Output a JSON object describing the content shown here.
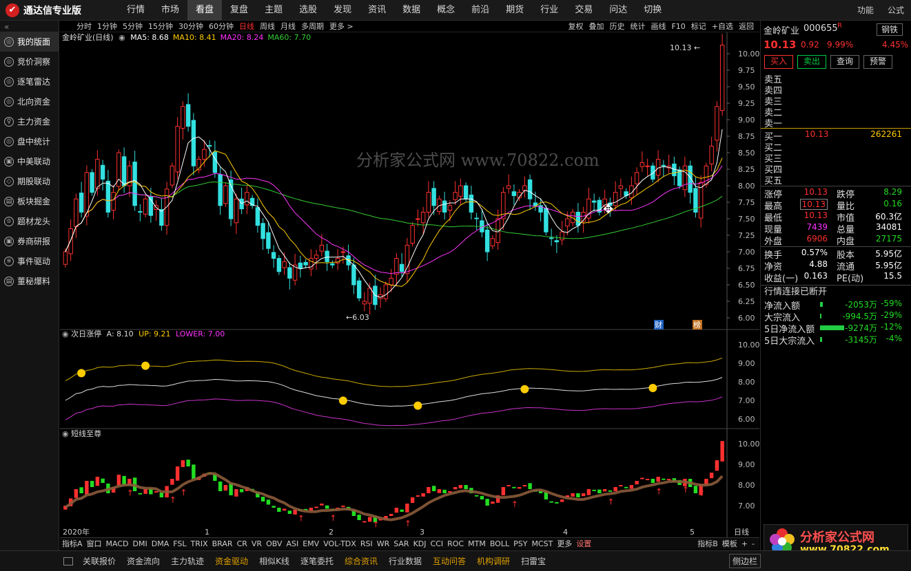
{
  "app": {
    "name": "通达信专业版"
  },
  "menu": [
    "行情",
    "市场",
    "看盘",
    "复盘",
    "主题",
    "选股",
    "发现",
    "资讯",
    "数据",
    "概念",
    "前沿",
    "期货",
    "行业",
    "交易",
    "问达",
    "切换"
  ],
  "menu_active": 2,
  "top_right": [
    "功能",
    "公式"
  ],
  "sidebar": {
    "collapse": "«",
    "items": [
      "我的版面",
      "竞价洞察",
      "逐笔雷达",
      "北向资金",
      "主力资金",
      "盘中统计",
      "中美联动",
      "期股联动",
      "板块掘金",
      "题材龙头",
      "券商研报",
      "事件驱动",
      "董秘爆料"
    ]
  },
  "period_tabs": [
    "分时",
    "1分钟",
    "5分钟",
    "15分钟",
    "30分钟",
    "60分钟",
    "日线",
    "周线",
    "月线",
    "多周期",
    "更多 >"
  ],
  "period_active": 6,
  "tool_tabs": [
    "复权",
    "叠加",
    "历史",
    "统计",
    "画线",
    "F10",
    "标记",
    "+自选",
    "返回"
  ],
  "main_panel": {
    "title": "金岭矿业(日线)",
    "ma": [
      {
        "label": "MA5: 8.68",
        "color": "#ffffff"
      },
      {
        "label": "MA10: 8.41",
        "color": "#ffcc00"
      },
      {
        "label": "MA20: 8.24",
        "color": "#ff33ff"
      },
      {
        "label": "MA60: 7.70",
        "color": "#33cc33"
      }
    ],
    "high_label": "10.13",
    "low_label": "6.03",
    "badge1": "财",
    "badge2": "榜"
  },
  "ind1": {
    "title": "次日涨停",
    "a": "A: 8.10",
    "up": "UP: 9.21",
    "lower": "LOWER: 7.00"
  },
  "ind2": {
    "title": "短线至尊"
  },
  "x_axis": {
    "labels": [
      "2020年",
      "1",
      "2",
      "3",
      "4",
      "5"
    ],
    "right": "日线"
  },
  "indicator_tabs": [
    "指标A",
    "窗口",
    "MACD",
    "DMI",
    "DMA",
    "FSL",
    "TRIX",
    "BRAR",
    "CR",
    "VR",
    "OBV",
    "ASI",
    "EMV",
    "VOL-TDX",
    "RSI",
    "WR",
    "SAR",
    "KDJ",
    "CCI",
    "ROC",
    "MTM",
    "BOLL",
    "PSY",
    "MCST",
    "更多",
    "设置"
  ],
  "indicator_right": [
    "指标B",
    "模板",
    "+",
    "-"
  ],
  "bottom_tabs": [
    "关联报价",
    "资金流向",
    "主力轨迹",
    "资金驱动",
    "相似K线",
    "逐笔委托",
    "综合资讯",
    "行业数据",
    "互动问答",
    "机构调研",
    "扫雷宝"
  ],
  "bottom_right": "侧边栏",
  "quote": {
    "name": "金岭矿业",
    "code": "000655",
    "flag": "R",
    "sector": "钢铁",
    "sector_pct": "4.45%",
    "price": "10.13",
    "change": "0.92",
    "pct": "9.99%",
    "buttons": [
      "买入",
      "卖出",
      "查询",
      "预警"
    ],
    "sells": [
      "卖五",
      "卖四",
      "卖三",
      "卖二",
      "卖一"
    ],
    "buys": [
      {
        "label": "买一",
        "price": "10.13",
        "vol": "262261"
      },
      {
        "label": "买二",
        "price": "",
        "vol": ""
      },
      {
        "label": "买三",
        "price": "",
        "vol": ""
      },
      {
        "label": "买四",
        "price": "",
        "vol": ""
      },
      {
        "label": "买五",
        "price": "",
        "vol": ""
      }
    ],
    "stats": [
      {
        "l1": "涨停",
        "v1": "10.13",
        "c1": "#ff3030",
        "l2": "跌停",
        "v2": "8.29",
        "c2": "#22dd22"
      },
      {
        "l1": "最高",
        "v1": "10.13",
        "c1": "#ff3030",
        "l2": "量比",
        "v2": "0.16",
        "c2": "#22dd22"
      },
      {
        "l1": "最低",
        "v1": "10.13",
        "c1": "#ff3030",
        "l2": "市值",
        "v2": "60.3亿",
        "c2": "#ffffff"
      },
      {
        "l1": "现量",
        "v1": "7439",
        "c1": "#ff33ff",
        "l2": "总量",
        "v2": "34081",
        "c2": "#ffffff"
      },
      {
        "l1": "外盘",
        "v1": "6906",
        "c1": "#ff3030",
        "l2": "内盘",
        "v2": "27175",
        "c2": "#22dd22"
      }
    ],
    "stats2": [
      {
        "l1": "换手",
        "v1": "0.57%",
        "l2": "股本",
        "v2": "5.95亿"
      },
      {
        "l1": "净资",
        "v1": "4.88",
        "l2": "流通",
        "v2": "5.95亿"
      },
      {
        "l1": "收益(一)",
        "v1": "0.163",
        "l2": "PE(动)",
        "v2": "15.5"
      }
    ],
    "status": "行情连接已断开",
    "flows": [
      {
        "label": "净流入额",
        "value": "-2053万",
        "pct": "-59%",
        "bar": 0.04
      },
      {
        "label": "大宗流入",
        "value": "-994.5万",
        "pct": "-29%",
        "bar": 0.02
      },
      {
        "label": "5日净流入额",
        "value": "-9274万",
        "pct": "-12%",
        "bar": 0.35
      },
      {
        "label": "5日大宗流入",
        "value": "-3145万",
        "pct": "-4%",
        "bar": 0.03
      }
    ]
  },
  "watermark": "分析家公式网 www.70822.com",
  "brand_footer": {
    "name": "分析家公式网",
    "url": "www.70822.com"
  },
  "chart_data": {
    "type": "candlestick",
    "y_main": [
      6.0,
      10.0
    ],
    "y_main_ticks": [
      "10.00",
      "9.75",
      "9.50",
      "9.25",
      "9.00",
      "8.75",
      "8.50",
      "8.25",
      "8.00",
      "7.75",
      "7.50",
      "7.25",
      "7.00",
      "6.75",
      "6.50",
      "6.25",
      "6.00"
    ],
    "y_ind1_ticks": [
      "10.00",
      "9.00",
      "8.00",
      "7.00",
      "6.00"
    ],
    "y_ind2_ticks": [
      "10.00",
      "9.00",
      "8.00",
      "7.00"
    ],
    "close": [
      7.0,
      7.35,
      7.8,
      7.6,
      8.2,
      7.9,
      8.4,
      8.1,
      7.6,
      7.9,
      8.5,
      8.0,
      8.3,
      7.7,
      7.6,
      7.8,
      7.55,
      7.7,
      7.4,
      7.95,
      8.3,
      8.9,
      9.2,
      8.9,
      8.3,
      8.4,
      8.55,
      8.6,
      8.2,
      7.7,
      8.0,
      7.5,
      7.8,
      7.65,
      7.9,
      7.7,
      7.4,
      7.2,
      7.05,
      6.9,
      6.7,
      6.85,
      6.6,
      6.8,
      6.75,
      6.8,
      6.9,
      6.95,
      7.1,
      6.85,
      6.8,
      6.9,
      7.0,
      6.8,
      6.5,
      6.3,
      6.25,
      6.45,
      6.2,
      6.35,
      6.5,
      6.6,
      6.9,
      6.7,
      7.1,
      7.4,
      7.5,
      7.6,
      7.9,
      7.7,
      7.8,
      7.6,
      7.7,
      7.9,
      8.0,
      7.8,
      7.6,
      7.5,
      7.3,
      7.0,
      7.2,
      7.5,
      7.9,
      8.0,
      7.85,
      7.9,
      8.0,
      7.8,
      7.7,
      7.6,
      7.3,
      7.2,
      7.15,
      7.3,
      7.5,
      7.6,
      7.4,
      7.6,
      7.8,
      7.75,
      7.6,
      7.8,
      7.7,
      7.9,
      8.0,
      7.85,
      8.0,
      8.2,
      8.35,
      8.3,
      8.1,
      8.4,
      8.3,
      8.3,
      8.15,
      8.0,
      8.3,
      7.9,
      7.6,
      8.05,
      8.3,
      8.6,
      9.2,
      10.13
    ]
  }
}
